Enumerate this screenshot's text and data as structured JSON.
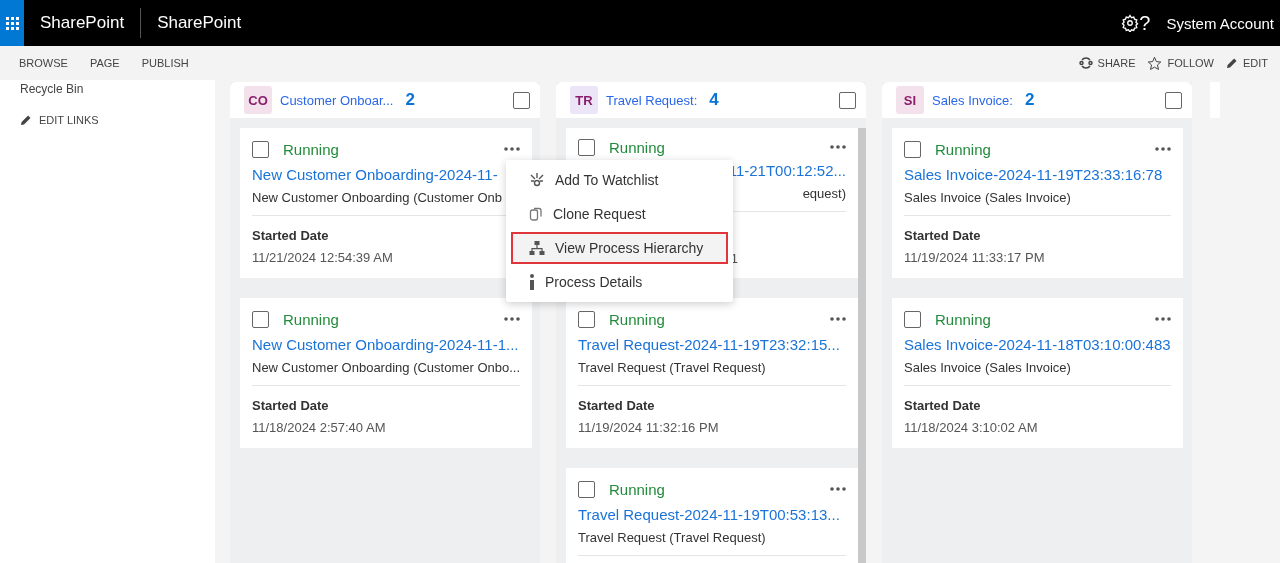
{
  "top_bar": {
    "app_name": "SharePoint",
    "site_name": "SharePoint",
    "help": "?",
    "user": "System Account"
  },
  "ribbon": {
    "tabs": [
      "BROWSE",
      "PAGE",
      "PUBLISH"
    ],
    "actions": [
      {
        "kind": "share",
        "label": "SHARE"
      },
      {
        "kind": "follow",
        "label": "FOLLOW"
      },
      {
        "kind": "edit",
        "label": "EDIT"
      }
    ]
  },
  "left_nav": {
    "items": [
      "Recycle Bin"
    ],
    "edit_links": "EDIT LINKS"
  },
  "columns": [
    {
      "initials": "CO",
      "color": "#f3e1ec",
      "title": "Customer Onboar...",
      "count": "2",
      "checked": false,
      "cards": [
        {
          "kind": "partly_covered_left",
          "checked": false,
          "status": "Running",
          "title": "New Customer Onboarding-2024-11-",
          "subtitle": "New Customer Onboarding (Customer Onb",
          "date_label": "Started Date",
          "date": "11/21/2024 12:54:39 AM"
        },
        {
          "kind": "full",
          "checked": false,
          "status": "Running",
          "title": "New Customer Onboarding-2024-11-1...",
          "subtitle": "New Customer Onboarding (Customer Onbo...",
          "date_label": "Started Date",
          "date": "11/18/2024 2:57:40 AM"
        }
      ]
    },
    {
      "initials": "TR",
      "color": "#ebe5f7",
      "title": "Travel Request:",
      "count": "4",
      "checked": false,
      "cards": [
        {
          "kind": "partly_covered_right",
          "checked": false,
          "status": "Running",
          "title": "11-21T00:12:52...",
          "subtitle": "equest)",
          "date": "1"
        },
        {
          "kind": "full",
          "checked": false,
          "status": "Running",
          "title": "Travel Request-2024-11-19T23:32:15...",
          "subtitle": "Travel Request (Travel Request)",
          "date_label": "Started Date",
          "date": "11/19/2024 11:32:16 PM"
        },
        {
          "kind": "full",
          "checked": false,
          "status": "Running",
          "title": "Travel Request-2024-11-19T00:53:13...",
          "subtitle": "Travel Request (Travel Request)"
        }
      ]
    },
    {
      "initials": "SI",
      "color": "#f3e1ec",
      "title": "Sales Invoice:",
      "count": "2",
      "checked": false,
      "cards": [
        {
          "kind": "full",
          "checked": false,
          "status": "Running",
          "title": "Sales Invoice-2024-11-19T23:33:16:78",
          "subtitle": "Sales Invoice (Sales Invoice)",
          "date_label": "Started Date",
          "date": "11/19/2024 11:33:17 PM"
        },
        {
          "kind": "full",
          "checked": false,
          "status": "Running",
          "title": "Sales Invoice-2024-11-18T03:10:00:483",
          "subtitle": "Sales Invoice (Sales Invoice)",
          "date_label": "Started Date",
          "date": "11/18/2024 3:10:02 AM"
        }
      ]
    }
  ],
  "context_menu": {
    "items": [
      {
        "kind": "watch",
        "label": "Add To Watchlist",
        "selected": false
      },
      {
        "kind": "clone",
        "label": "Clone Request",
        "selected": false
      },
      {
        "kind": "hierarchy",
        "label": "View Process Hierarchy",
        "selected": true
      },
      {
        "kind": "info",
        "label": "Process Details",
        "selected": false
      }
    ]
  }
}
